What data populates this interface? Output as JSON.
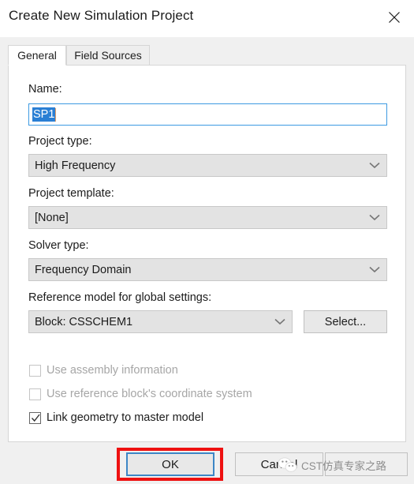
{
  "dialog": {
    "title": "Create New Simulation Project",
    "close_icon": "close-icon"
  },
  "tabs": [
    {
      "label": "General",
      "active": true
    },
    {
      "label": "Field Sources",
      "active": false
    }
  ],
  "form": {
    "name": {
      "label": "Name:",
      "value": "SP1",
      "selected": true
    },
    "project_type": {
      "label": "Project type:",
      "value": "High Frequency"
    },
    "project_template": {
      "label": "Project template:",
      "value": "[None]"
    },
    "solver_type": {
      "label": "Solver type:",
      "value": "Frequency Domain"
    },
    "reference_model": {
      "label": "Reference model for global settings:",
      "value": "Block: CSSCHEM1",
      "select_button": "Select..."
    },
    "checkboxes": [
      {
        "label": "Use assembly information",
        "checked": false,
        "enabled": false
      },
      {
        "label": "Use reference block's coordinate system",
        "checked": false,
        "enabled": false
      },
      {
        "label": "Link geometry to master model",
        "checked": true,
        "enabled": true
      }
    ]
  },
  "footer": {
    "ok_label": "OK",
    "cancel_label": "Cancel",
    "third_label": ""
  },
  "watermark": {
    "text": "CST仿真专家之路"
  },
  "colors": {
    "focus_blue": "#3d86c6",
    "selection_blue": "#2a7fd4",
    "annotation_red": "#ee1111",
    "panel_bg": "#ffffff",
    "dialog_bg": "#f0f0f0",
    "combo_bg": "#e3e3e3"
  }
}
